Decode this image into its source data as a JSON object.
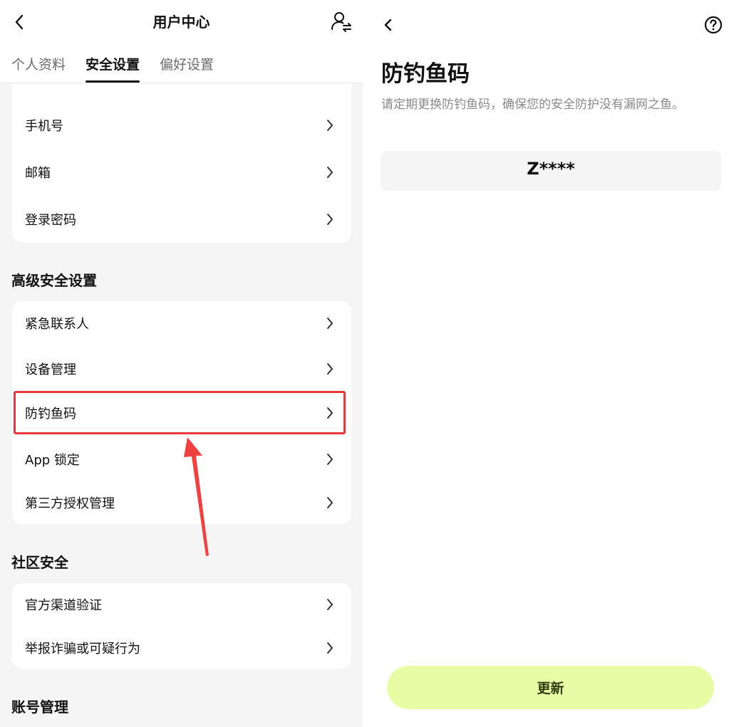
{
  "left": {
    "header": {
      "title": "用户中心"
    },
    "tabs": [
      {
        "label": "个人资料",
        "active": false
      },
      {
        "label": "安全设置",
        "active": true
      },
      {
        "label": "偏好设置",
        "active": false
      }
    ],
    "account_card": {
      "items": [
        {
          "label": "手机号"
        },
        {
          "label": "邮箱"
        },
        {
          "label": "登录密码"
        }
      ]
    },
    "advanced": {
      "title": "高级安全设置",
      "items": [
        {
          "label": "紧急联系人"
        },
        {
          "label": "设备管理"
        },
        {
          "label": "防钓鱼码",
          "highlighted": true
        },
        {
          "label": "App 锁定"
        },
        {
          "label": "第三方授权管理"
        }
      ]
    },
    "community": {
      "title": "社区安全",
      "items": [
        {
          "label": "官方渠道验证"
        },
        {
          "label": "举报诈骗或可疑行为"
        }
      ]
    },
    "account_mgmt": {
      "title": "账号管理"
    }
  },
  "right": {
    "title": "防钓鱼码",
    "description": "请定期更换防钓鱼码，确保您的安全防护没有漏网之鱼。",
    "code": "Z****",
    "update_button": "更新"
  },
  "colors": {
    "highlight_border": "#e8383d",
    "arrow": "#f04040",
    "update_button_bg": "#e8fca6",
    "left_bg": "#f5f5f5"
  }
}
